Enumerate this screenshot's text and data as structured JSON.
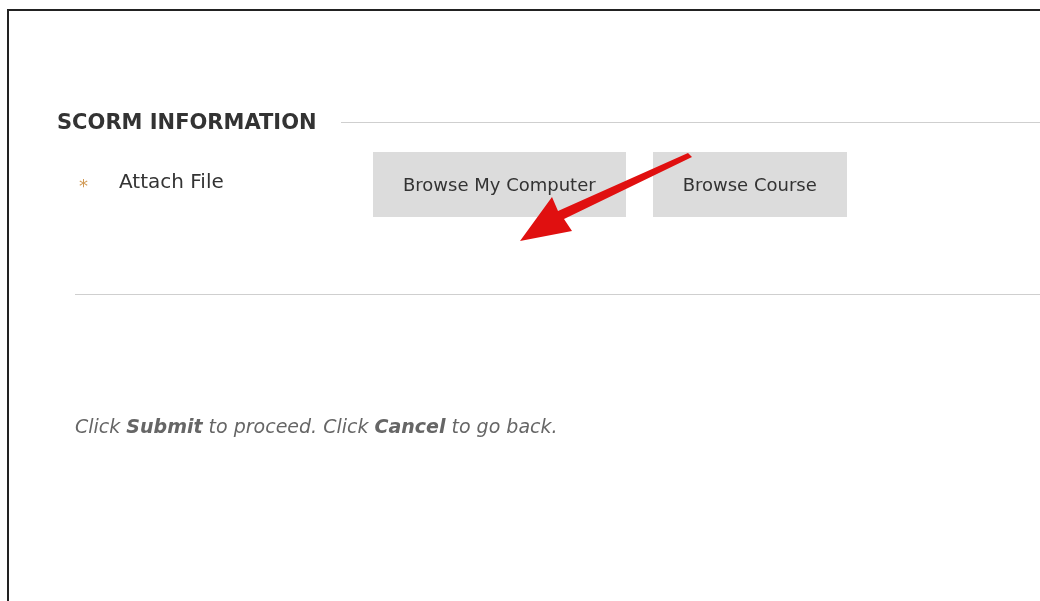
{
  "section": {
    "title": "SCORM INFORMATION"
  },
  "field": {
    "required_mark": "*",
    "label": "Attach File",
    "buttons": [
      "Browse My Computer",
      "Browse Course"
    ]
  },
  "footer": {
    "text": "Click **Submit** to proceed. Click **Cancel** to go back."
  }
}
